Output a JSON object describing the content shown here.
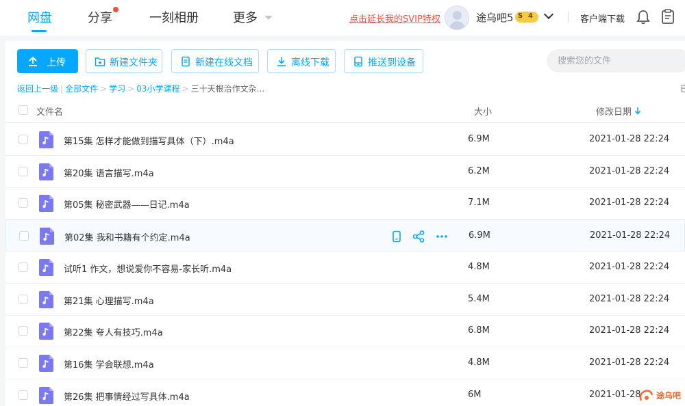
{
  "nav": {
    "tabs": [
      "网盘",
      "分享",
      "一刻相册",
      "更多"
    ],
    "svip_link": "点击延长我的SVIP特权",
    "username": "途乌吧5",
    "level_s": "S",
    "level_num": "4",
    "client_download": "客户端下载"
  },
  "toolbar": {
    "upload": "上传",
    "new_folder": "新建文件夹",
    "new_doc": "新建在线文档",
    "offline_download": "离线下载",
    "push_device": "推送到设备",
    "search_placeholder": "搜索您的文件"
  },
  "breadcrumb": {
    "back": "返回上一级",
    "items": [
      "全部文件",
      "学习",
      "03小学课程"
    ],
    "current": "三十天根治作文杂...",
    "right_cut": "已"
  },
  "table": {
    "col_name": "文件名",
    "col_size": "大小",
    "col_date": "修改日期",
    "rows": [
      {
        "name": "第15集 怎样才能做到描写具体（下）.m4a",
        "size": "6.9M",
        "date": "2021-01-28 22:24"
      },
      {
        "name": "第20集 语言描写.m4a",
        "size": "6.2M",
        "date": "2021-01-28 22:24"
      },
      {
        "name": "第05集 秘密武器——日记.m4a",
        "size": "7.1M",
        "date": "2021-01-28 22:24"
      },
      {
        "name": "第02集 我和书籍有个约定.m4a",
        "size": "6.9M",
        "date": "2021-01-28 22:24"
      },
      {
        "name": "试听1 作文，想说爱你不容易-家长听.m4a",
        "size": "4.8M",
        "date": "2021-01-28 22:24"
      },
      {
        "name": "第21集 心理描写.m4a",
        "size": "5.4M",
        "date": "2021-01-28 22:24"
      },
      {
        "name": "第22集 夸人有技巧.m4a",
        "size": "6.8M",
        "date": "2021-01-28 22:24"
      },
      {
        "name": "第16集 学会联想.m4a",
        "size": "4.8M",
        "date": "2021-01-28 22:24"
      },
      {
        "name": "第26集 把事情经过写具体.m4a",
        "size": "6M",
        "date": "2021-01-28"
      }
    ]
  },
  "watermark": "途乌吧",
  "colors": {
    "accent": "#06a7ff",
    "alert": "#f5503d",
    "file_icon": "#7b79f0"
  }
}
